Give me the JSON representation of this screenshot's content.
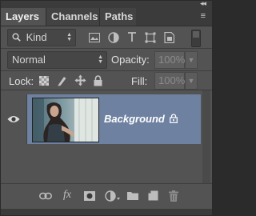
{
  "window": {
    "collapse_glyph": "◂◂",
    "menu_glyph": "≡"
  },
  "tabs": [
    {
      "label": "Layers",
      "active": true
    },
    {
      "label": "Channels",
      "active": false
    },
    {
      "label": "Paths",
      "active": false
    }
  ],
  "filter": {
    "kind_label": "Kind",
    "search_glyph": "⌕",
    "filter_icons": [
      "image-filter-icon",
      "adjustment-filter-icon",
      "type-filter-icon",
      "shape-filter-icon",
      "smart-object-filter-icon"
    ]
  },
  "blend": {
    "mode": "Normal",
    "opacity_label": "Opacity:",
    "opacity_value": "100%"
  },
  "lock": {
    "label": "Lock:",
    "icons": [
      "lock-transparent-pixels-icon",
      "lock-image-pixels-icon",
      "lock-position-icon",
      "lock-all-icon"
    ],
    "fill_label": "Fill:",
    "fill_value": "100%"
  },
  "layers": [
    {
      "name": "Background",
      "visible": true,
      "locked": true,
      "selected": true
    }
  ],
  "bottom_icons": [
    "link-layers-icon",
    "fx-icon",
    "add-mask-icon",
    "adjustment-layer-icon",
    "new-group-icon",
    "new-layer-icon",
    "delete-layer-icon"
  ],
  "fx_label": "fx",
  "colors": {
    "panel_bg": "#535353",
    "selected_layer": "#6e81a0",
    "tab_bar": "#3b3b3b"
  }
}
